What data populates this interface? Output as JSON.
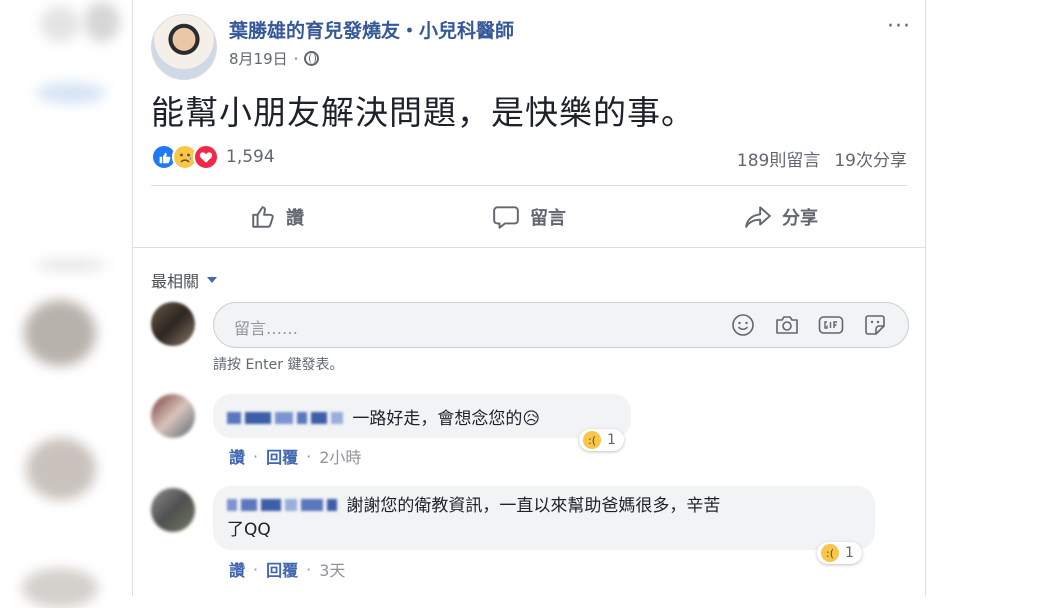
{
  "post": {
    "page_name": "葉勝雄的育兒發燒友・小兒科醫師",
    "date": "8月19日",
    "separator": "·",
    "more": "···",
    "text": "能幫小朋友解決問題，是快樂的事。",
    "reaction_count": "1,594",
    "comment_count": "189則留言",
    "share_count": "19次分享"
  },
  "actions": {
    "like": "讚",
    "comment": "留言",
    "share": "分享"
  },
  "comments_section": {
    "sort_label": "最相關",
    "input_placeholder": "留言……",
    "hint": "請按 Enter 鍵發表。",
    "comments": [
      {
        "text": "一路好走，會想念您的😥",
        "reaction_count": "1",
        "like": "讚",
        "reply": "回覆",
        "time": "2小時"
      },
      {
        "text_line1": "謝謝您的衛教資訊，一直以來幫助爸媽很多，辛苦",
        "text_line2": "了QQ",
        "reaction_count": "1",
        "like": "讚",
        "reply": "回覆",
        "time": "3天"
      }
    ]
  },
  "colors": {
    "link_blue": "#365899",
    "like_blue": "#2078f4",
    "love_red": "#f0284a",
    "sad_yellow": "#f7c64b"
  },
  "icons": [
    "more-icon",
    "globe-icon",
    "like-icon",
    "comment-icon",
    "share-icon",
    "caret-down-icon",
    "emoji-icon",
    "camera-icon",
    "gif-icon",
    "sticker-icon",
    "sad-icon",
    "love-icon"
  ]
}
